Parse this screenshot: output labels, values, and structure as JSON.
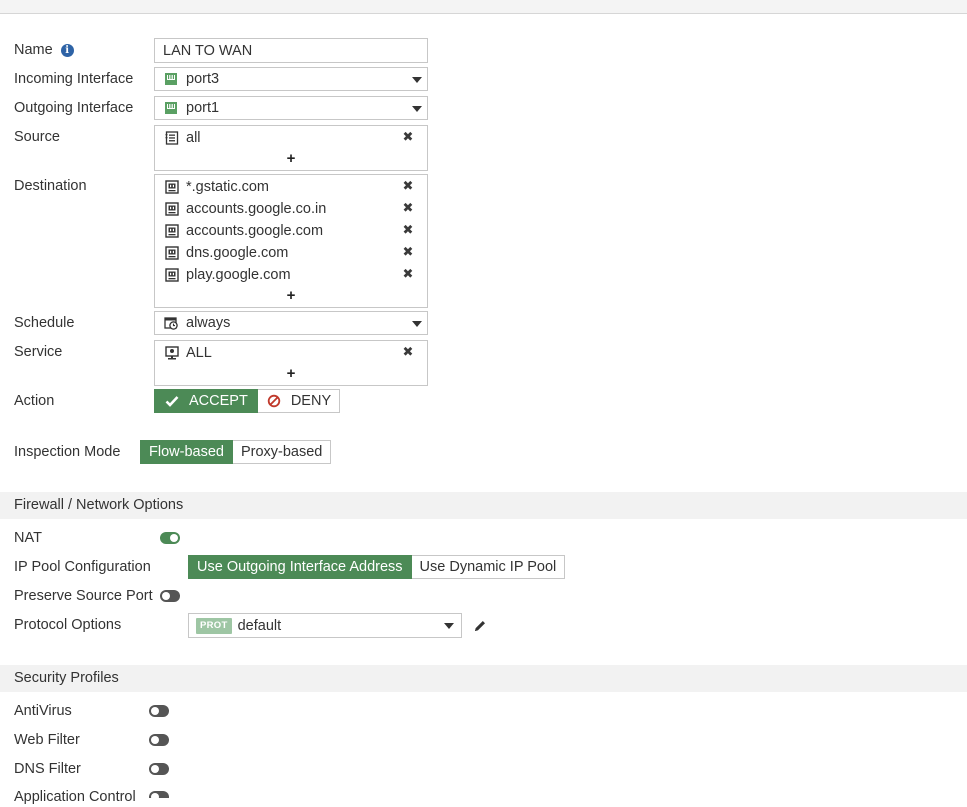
{
  "form": {
    "name": {
      "label": "Name",
      "value": "LAN TO WAN",
      "info_icon": "info-icon"
    },
    "incoming": {
      "label": "Incoming Interface",
      "value": "port3",
      "icon": "network-port-icon"
    },
    "outgoing": {
      "label": "Outgoing Interface",
      "value": "port1",
      "icon": "network-port-icon"
    },
    "source": {
      "label": "Source",
      "items": [
        "all"
      ],
      "add": "+"
    },
    "destination": {
      "label": "Destination",
      "items": [
        "*.gstatic.com",
        "accounts.google.co.in",
        "accounts.google.com",
        "dns.google.com",
        "play.google.com"
      ],
      "add": "+"
    },
    "schedule": {
      "label": "Schedule",
      "value": "always",
      "icon": "schedule-icon"
    },
    "service": {
      "label": "Service",
      "items": [
        "ALL"
      ],
      "add": "+"
    },
    "action": {
      "label": "Action",
      "accept": "ACCEPT",
      "deny": "DENY",
      "selected": "ACCEPT"
    },
    "inspection": {
      "label": "Inspection Mode",
      "options": [
        "Flow-based",
        "Proxy-based"
      ],
      "selected": "Flow-based"
    }
  },
  "firewall": {
    "title": "Firewall / Network Options",
    "nat": {
      "label": "NAT",
      "enabled": true
    },
    "ip_pool": {
      "label": "IP Pool Configuration",
      "options": [
        "Use Outgoing Interface Address",
        "Use Dynamic IP Pool"
      ],
      "selected": "Use Outgoing Interface Address"
    },
    "preserve": {
      "label": "Preserve Source Port",
      "enabled": false
    },
    "protocol": {
      "label": "Protocol Options",
      "badge": "PROT",
      "value": "default"
    }
  },
  "security": {
    "title": "Security Profiles",
    "profiles": [
      {
        "label": "AntiVirus",
        "enabled": false
      },
      {
        "label": "Web Filter",
        "enabled": false
      },
      {
        "label": "DNS Filter",
        "enabled": false
      },
      {
        "label": "Application Control",
        "enabled": false
      }
    ]
  },
  "colors": {
    "accent_green": "#4c8a56",
    "deny_red": "#c0392b",
    "info_blue": "#2e63a6"
  }
}
